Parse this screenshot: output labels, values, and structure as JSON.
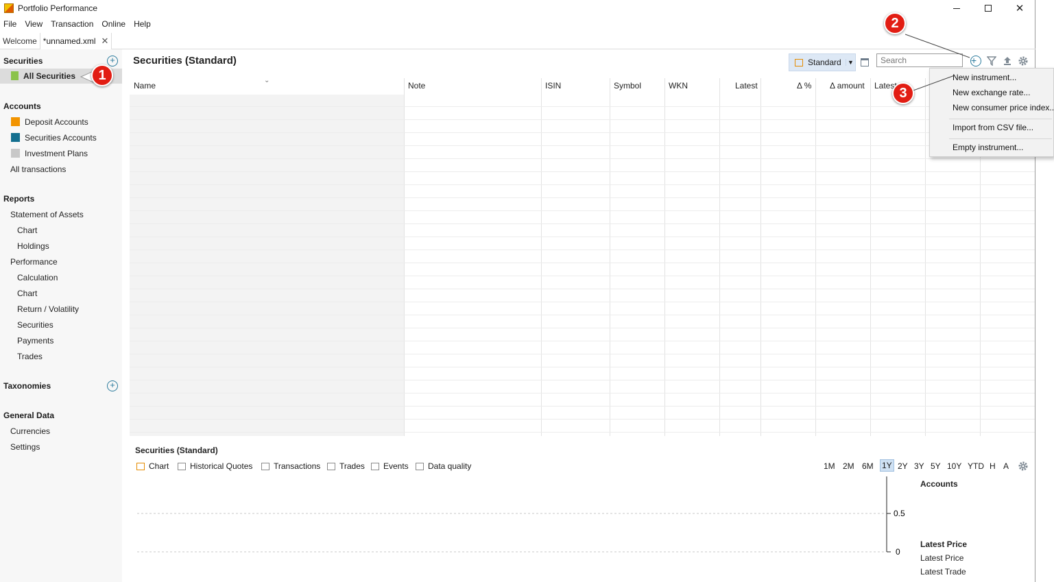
{
  "window": {
    "title": "Portfolio Performance",
    "controls": {
      "minimize": "—",
      "maximize": "☐",
      "close": "✕"
    }
  },
  "menu": [
    "File",
    "View",
    "Transaction",
    "Online",
    "Help"
  ],
  "tabs": [
    {
      "label": "Welcome"
    },
    {
      "label": "*unnamed.xml",
      "close": "✕"
    }
  ],
  "sidebar": {
    "securities": {
      "heading": "Securities",
      "items": [
        "All Securities"
      ]
    },
    "accounts": {
      "heading": "Accounts",
      "items": [
        "Deposit Accounts",
        "Securities Accounts",
        "Investment Plans",
        "All transactions"
      ]
    },
    "reports": {
      "heading": "Reports",
      "items": [
        "Statement of Assets",
        "Chart",
        "Holdings",
        "Performance",
        "Calculation",
        "Chart",
        "Return / Volatility",
        "Securities",
        "Payments",
        "Trades"
      ]
    },
    "taxonomies": {
      "heading": "Taxonomies"
    },
    "general": {
      "heading": "General Data",
      "items": [
        "Currencies",
        "Settings"
      ]
    }
  },
  "main": {
    "title": "Securities (Standard)",
    "view_label": "Standard",
    "search_placeholder": "Search",
    "columns": [
      "Name",
      "Note",
      "ISIN",
      "Symbol",
      "WKN",
      "Latest",
      "Δ %",
      "Δ amount",
      "Latest"
    ]
  },
  "popup_menu": [
    "New instrument...",
    "New exchange rate...",
    "New consumer price index...",
    "Import from CSV file...",
    "Empty instrument..."
  ],
  "bottom": {
    "title": "Securities (Standard)",
    "tabs": [
      "Chart",
      "Historical Quotes",
      "Transactions",
      "Trades",
      "Events",
      "Data quality"
    ],
    "periods": [
      "1M",
      "2M",
      "6M",
      "1Y",
      "2Y",
      "3Y",
      "5Y",
      "10Y",
      "YTD",
      "H",
      "A"
    ],
    "active_period": "1Y",
    "y_ticks": [
      "0.5",
      "0"
    ],
    "legend": {
      "accounts_heading": "Accounts",
      "price_heading": "Latest Price",
      "items": [
        "Latest Price",
        "Latest Trade"
      ]
    }
  },
  "badges": [
    "1",
    "2",
    "3"
  ],
  "colors": {
    "accent_orange": "#e58b00",
    "accent_blue": "#2a7a9c",
    "badge_red": "#e21d13",
    "deposit": "#f29400",
    "securities": "#136f8f",
    "plans": "#c8c8c8"
  }
}
